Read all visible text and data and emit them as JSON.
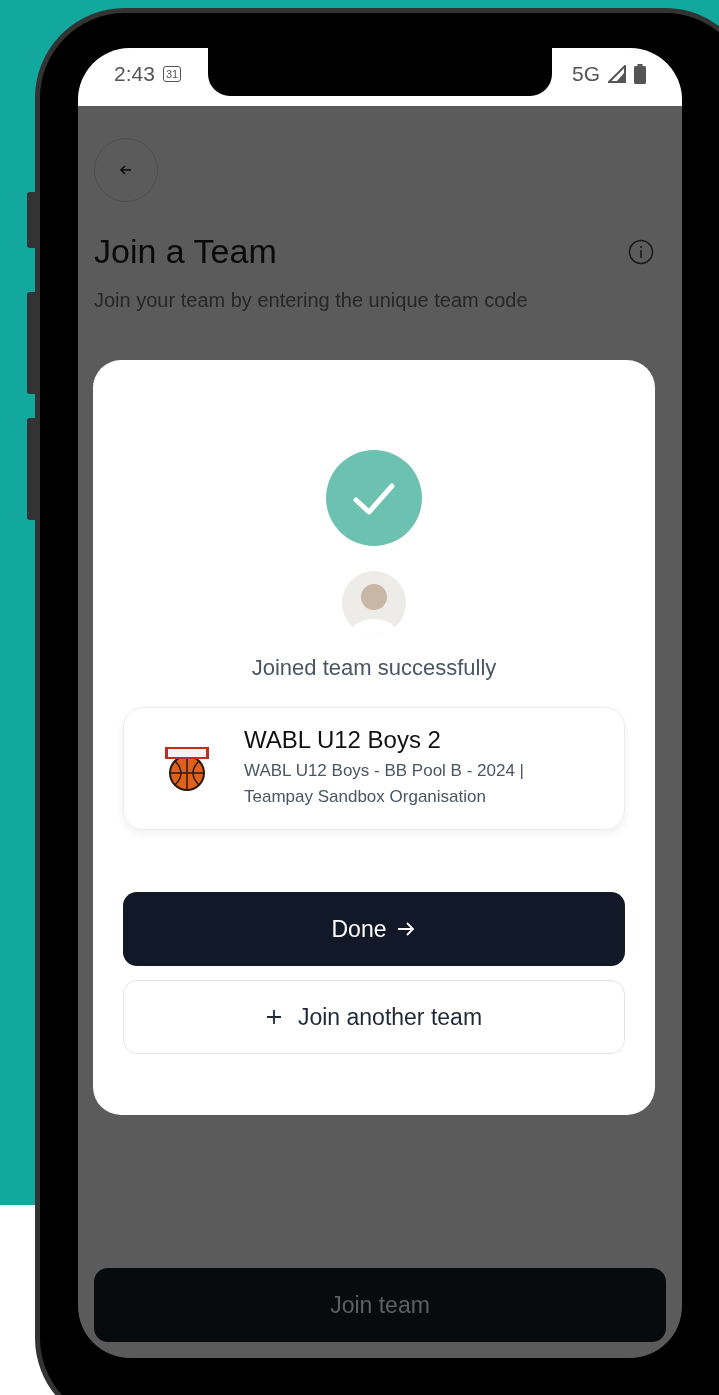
{
  "status_bar": {
    "time": "2:43",
    "calendar_day": "31",
    "network": "5G"
  },
  "page": {
    "title": "Join a Team",
    "subtitle": "Join your team by entering the unique team code",
    "main_button": "Join team"
  },
  "dialog": {
    "message": "Joined team successfully",
    "team": {
      "name": "WABL U12 Boys 2",
      "details": "WABL U12 Boys - BB Pool B - 2024 | Teampay Sandbox Organisation"
    },
    "buttons": [
      {
        "label": "Done",
        "kind": "primary"
      },
      {
        "label": "Join another team",
        "kind": "secondary"
      }
    ]
  }
}
